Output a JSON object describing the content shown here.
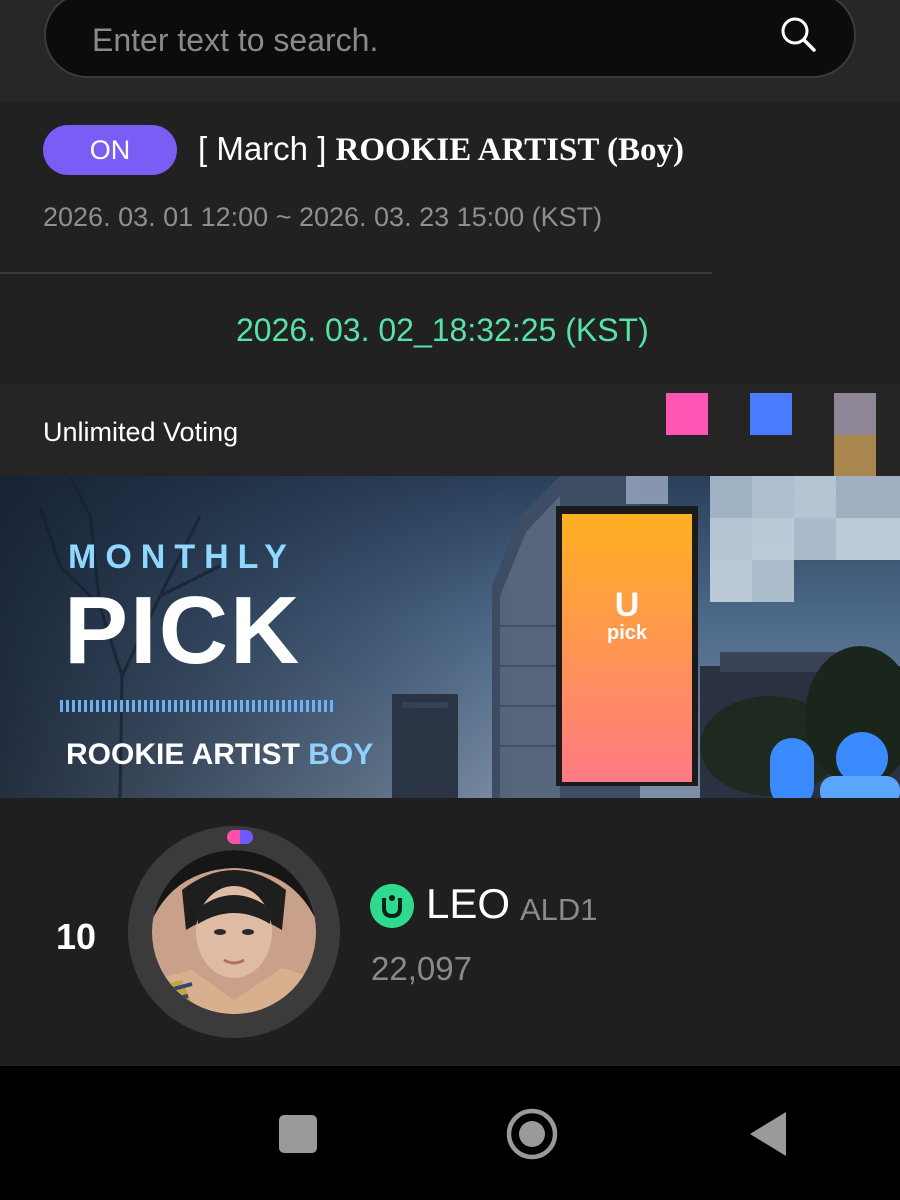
{
  "search": {
    "placeholder": "Enter text to search."
  },
  "event": {
    "status_badge": "ON",
    "title_bracket": "[ March ]",
    "title_name": "ROOKIE ARTIST (Boy)",
    "period": "2026. 03. 01 12:00 ~ 2026. 03. 23 15:00 (KST)",
    "current_time": "2026. 03. 02_18:32:25 (KST)"
  },
  "voting": {
    "label": "Unlimited Voting"
  },
  "banner": {
    "line1": "MONTHLY",
    "line2": "PICK",
    "subtitle_main": "ROOKIE ARTIST",
    "subtitle_accent": "BOY",
    "screen_logo_top": "U",
    "screen_logo_bottom": "pick"
  },
  "ranking": {
    "rank": "10",
    "artist_name": "LEO",
    "group": "ALD1",
    "votes": "22,097"
  },
  "colors": {
    "accent_purple": "#7b5cf5",
    "time_green": "#56e3a6",
    "artist_icon_green": "#2fd990"
  },
  "icons": {
    "search": "search-icon",
    "nav_recent": "square-icon",
    "nav_home": "circle-icon",
    "nav_back": "back-triangle-icon"
  }
}
